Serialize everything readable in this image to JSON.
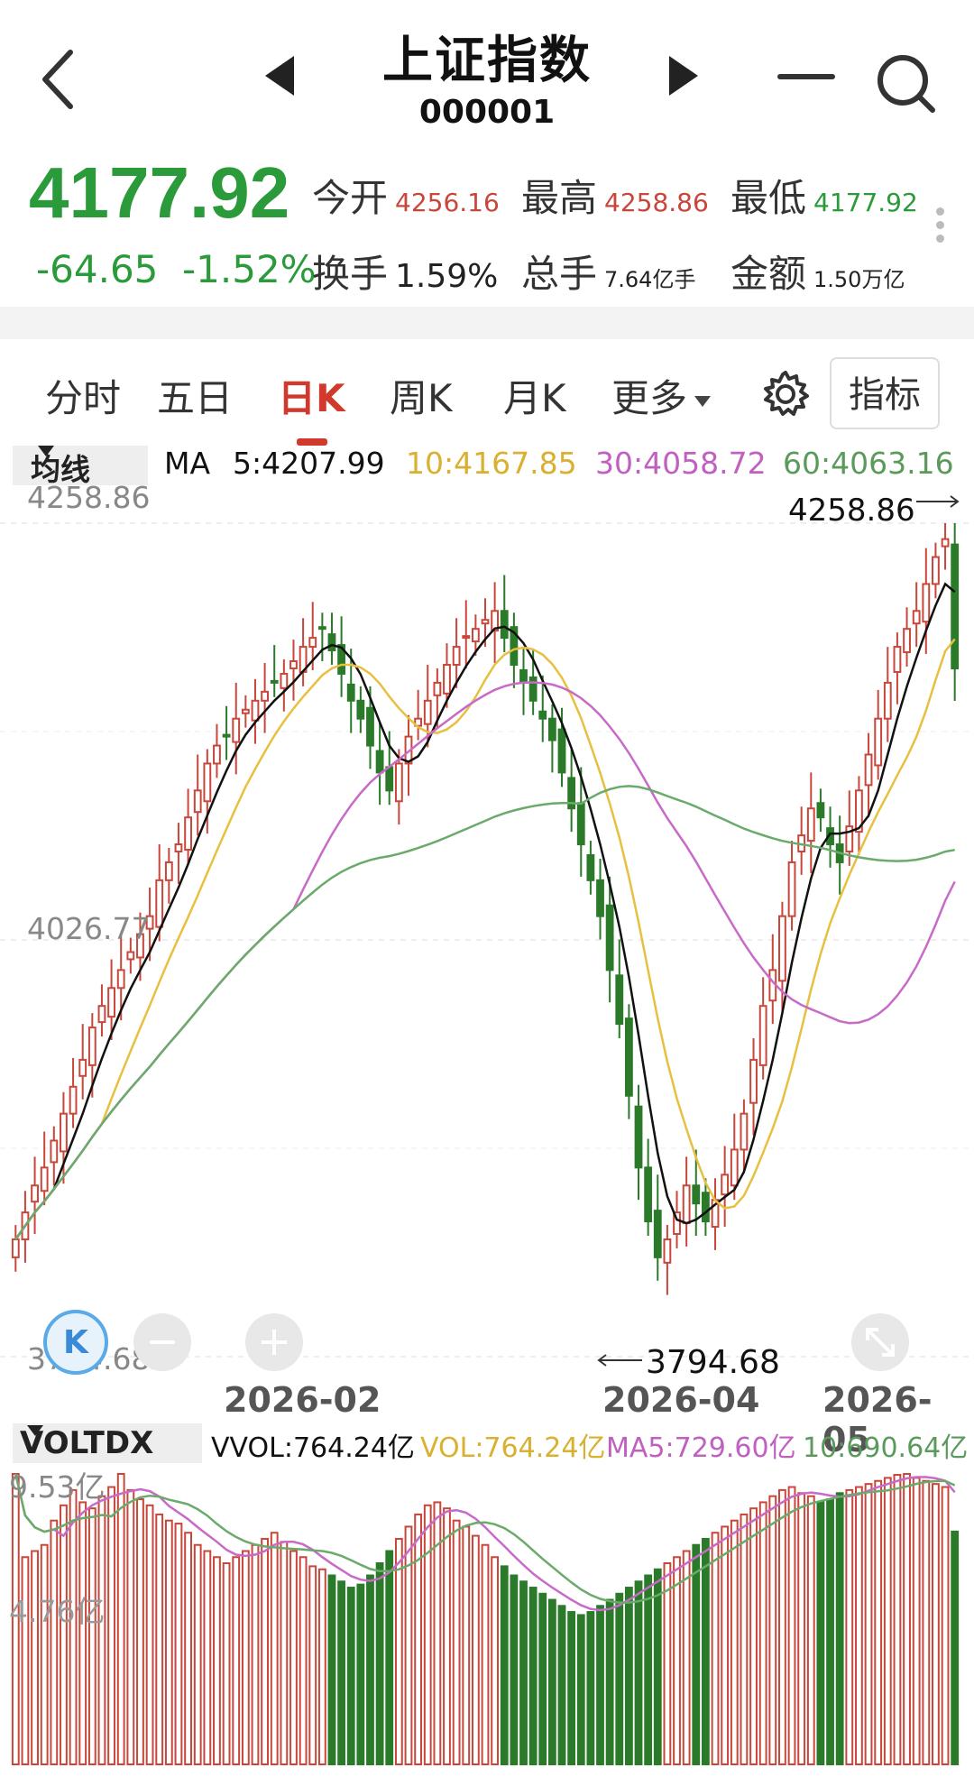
{
  "header": {
    "title": "上证指数",
    "code": "000001"
  },
  "quote": {
    "price": "4177.92",
    "change": "-64.65",
    "change_pct": "-1.52%",
    "open_label": "今开",
    "open": "4256.16",
    "high_label": "最高",
    "high": "4258.86",
    "low_label": "最低",
    "low": "4177.92",
    "turnover_label": "换手",
    "turnover": "1.59%",
    "volume_label": "总手",
    "volume": "7.64亿手",
    "amount_label": "金额",
    "amount": "1.50万亿"
  },
  "tabs": [
    "分时",
    "五日",
    "日K",
    "周K",
    "月K",
    "更多"
  ],
  "active_tab": "日K",
  "indicator_button": "指标",
  "ma": {
    "selector": "均线",
    "prefix": "MA",
    "ma5": "5:4207.99",
    "ma10": "10:4167.85",
    "ma30": "30:4058.72",
    "ma60": "60:4063.16"
  },
  "colors": {
    "up": "#c8463a",
    "down": "#2a7a2a",
    "ma5": "#111111",
    "ma10": "#e8c040",
    "ma30": "#c86ac8",
    "ma60": "#6aaa6a"
  },
  "price_axis": {
    "top": "4258.86",
    "mid": "4026.77",
    "bottom": "3794.68"
  },
  "price_marks": {
    "high": "4258.86",
    "low": "3794.68"
  },
  "x_labels": [
    "2026-02",
    "2026-04",
    "2026-05"
  ],
  "volume": {
    "selector": "VOLTDX",
    "vvol": "VVOL:764.24亿",
    "vol": "VOL:764.24亿",
    "ma5": "MA5:729.60亿",
    "ma10": "10:690.64亿",
    "top": "9.53亿",
    "mid": "4.76亿"
  },
  "chart_data": {
    "type": "candlestick",
    "y_range": [
      3794.68,
      4258.86
    ],
    "closes": [
      3860,
      3875,
      3890,
      3900,
      3915,
      3930,
      3945,
      3960,
      3978,
      3990,
      4000,
      4010,
      4020,
      4030,
      4040,
      4060,
      4070,
      4080,
      4095,
      4110,
      4125,
      4135,
      4140,
      4150,
      4155,
      4160,
      4165,
      4170,
      4175,
      4182,
      4190,
      4195,
      4200,
      4188,
      4175,
      4160,
      4150,
      4135,
      4120,
      4110,
      4125,
      4140,
      4150,
      4160,
      4170,
      4180,
      4190,
      4196,
      4200,
      4205,
      4210,
      4195,
      4180,
      4170,
      4160,
      4150,
      4138,
      4120,
      4100,
      4080,
      4060,
      4040,
      4010,
      3980,
      3940,
      3900,
      3870,
      3850,
      3860,
      3875,
      3890,
      3880,
      3870,
      3882,
      3896,
      3910,
      3930,
      3960,
      3990,
      4010,
      4040,
      4070,
      4085,
      4100,
      4095,
      4080,
      4070,
      4090,
      4110,
      4130,
      4150,
      4170,
      4190,
      4200,
      4210,
      4225,
      4240,
      4250,
      4177.92
    ],
    "volumes": [
      9.53,
      6.8,
      7.0,
      7.2,
      8.0,
      8.5,
      9.0,
      8.6,
      8.4,
      8.8,
      9.1,
      9.53,
      9.0,
      8.7,
      8.5,
      8.2,
      8.0,
      7.9,
      7.6,
      7.2,
      7.0,
      6.8,
      6.6,
      6.8,
      7.0,
      7.2,
      7.4,
      7.6,
      7.3,
      7.0,
      6.8,
      6.5,
      6.4,
      6.2,
      6.0,
      5.8,
      5.9,
      6.2,
      6.6,
      7.0,
      7.4,
      7.8,
      8.2,
      8.5,
      8.6,
      8.4,
      8.0,
      7.8,
      7.5,
      7.2,
      6.8,
      6.5,
      6.2,
      6.0,
      5.8,
      5.6,
      5.4,
      5.2,
      5.0,
      4.9,
      5.0,
      5.2,
      5.4,
      5.6,
      5.8,
      6.0,
      6.2,
      6.4,
      6.6,
      6.8,
      7.0,
      7.2,
      7.4,
      7.6,
      7.8,
      8.0,
      8.2,
      8.4,
      8.6,
      8.8,
      9.0,
      9.1,
      8.9,
      8.8,
      8.6,
      8.7,
      8.9,
      9.0,
      9.1,
      9.2,
      9.3,
      9.4,
      9.5,
      9.53,
      9.4,
      9.3,
      9.2,
      9.1,
      7.64
    ],
    "volume_range": [
      0,
      9.53
    ]
  }
}
